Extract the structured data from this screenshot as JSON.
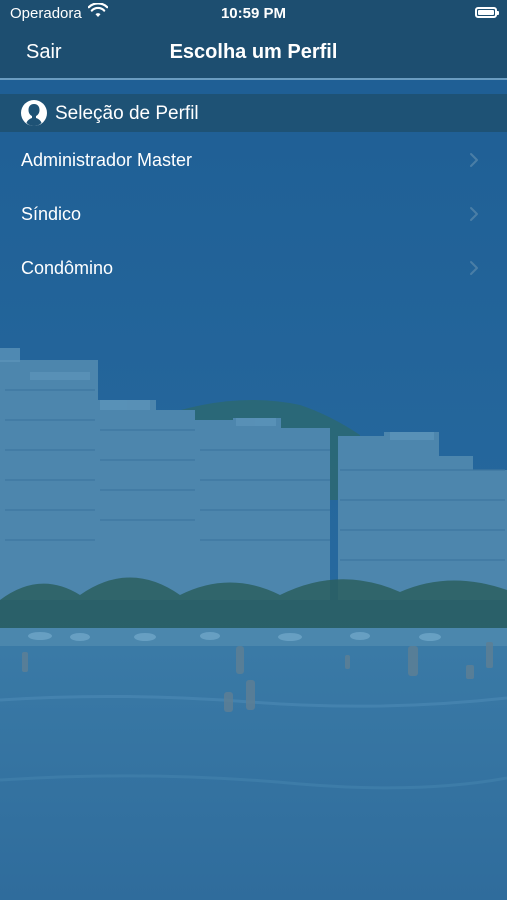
{
  "status_bar": {
    "carrier": "Operadora",
    "time": "10:59 PM",
    "wifi_icon": "wifi-icon",
    "battery_icon": "battery-icon"
  },
  "nav": {
    "back_label": "Sair",
    "title": "Escolha um Perfil"
  },
  "section": {
    "icon": "person-icon",
    "title": "Seleção de Perfil"
  },
  "profiles": [
    {
      "label": "Administrador Master",
      "icon": "chevron-right-icon"
    },
    {
      "label": "Síndico",
      "icon": "chevron-right-icon"
    },
    {
      "label": "Condômino",
      "icon": "chevron-right-icon"
    }
  ],
  "colors": {
    "nav_background": "#1d4e70",
    "overlay_tint": "#2a6a9c",
    "section_header": "#1e5275"
  }
}
